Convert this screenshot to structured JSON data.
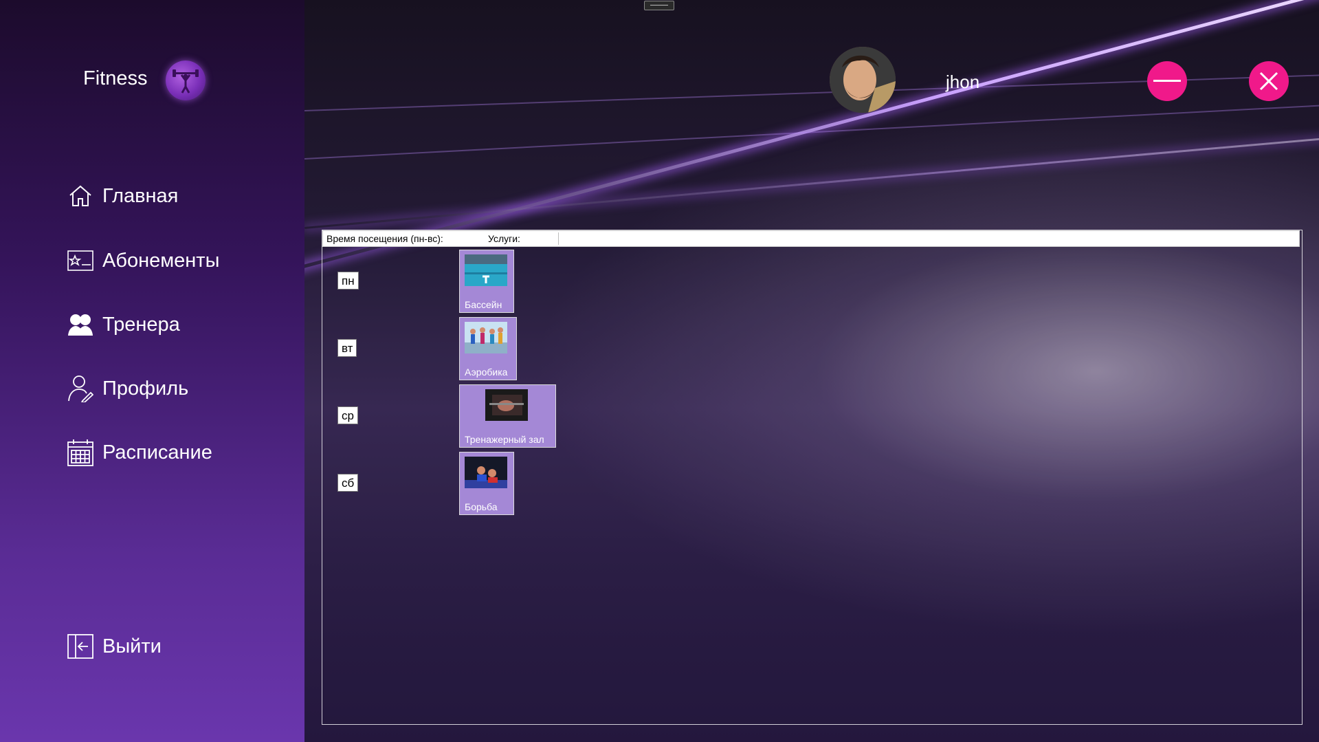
{
  "app": {
    "title": "Fitness"
  },
  "sidebar": {
    "items": [
      {
        "label": "Главная",
        "icon": "home-icon"
      },
      {
        "label": "Абонементы",
        "icon": "membership-card-icon"
      },
      {
        "label": "Тренера",
        "icon": "trainers-icon"
      },
      {
        "label": "Профиль",
        "icon": "profile-icon"
      },
      {
        "label": "Расписание",
        "icon": "calendar-icon"
      }
    ],
    "logout": {
      "label": "Выйти",
      "icon": "logout-icon"
    }
  },
  "header": {
    "username": "jhon"
  },
  "schedule": {
    "time_header": "Время посещения (пн-вс):",
    "services_header": "Услуги:",
    "days": [
      "пн",
      "вт",
      "ср",
      "сб"
    ],
    "services": [
      "Бассейн",
      "Аэробика",
      "Тренажерный зал",
      "Борьба"
    ]
  },
  "colors": {
    "accent_pink": "#f0198a",
    "sidebar_top": "#1c0b2c",
    "sidebar_bottom": "#6a36ad",
    "service_tile": "#a488d6"
  }
}
